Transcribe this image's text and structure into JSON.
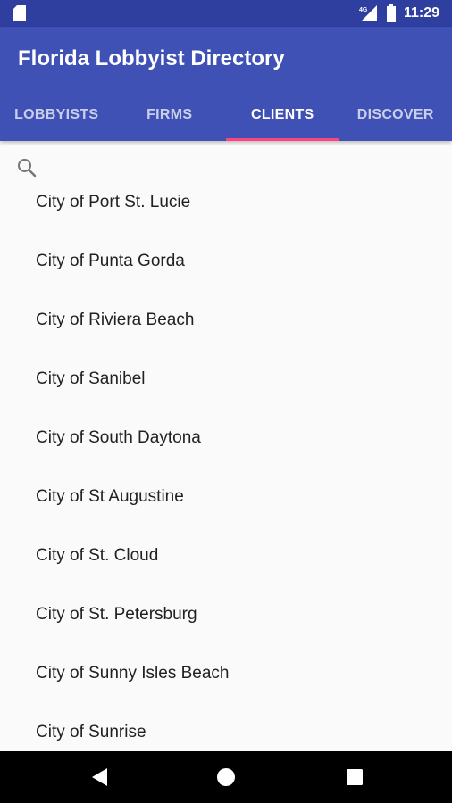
{
  "status_bar": {
    "network": "4G",
    "time": "11:29"
  },
  "app_bar": {
    "title": "Florida Lobbyist Directory",
    "tabs": [
      {
        "label": "LOBBYISTS",
        "active": false
      },
      {
        "label": "FIRMS",
        "active": false
      },
      {
        "label": "CLIENTS",
        "active": true
      },
      {
        "label": "DISCOVER",
        "active": false
      }
    ]
  },
  "search": {
    "icon": "search-icon"
  },
  "clients": [
    "City of Port St. Lucie",
    "City of Punta Gorda",
    "City of Riviera Beach",
    "City of Sanibel",
    "City of South Daytona",
    "City of St Augustine",
    "City of St. Cloud",
    "City of St. Petersburg",
    "City of Sunny Isles Beach",
    "City of Sunrise"
  ],
  "colors": {
    "primary": "#3f51b5",
    "primary_dark": "#2f3fa0",
    "accent": "#ff4081"
  }
}
